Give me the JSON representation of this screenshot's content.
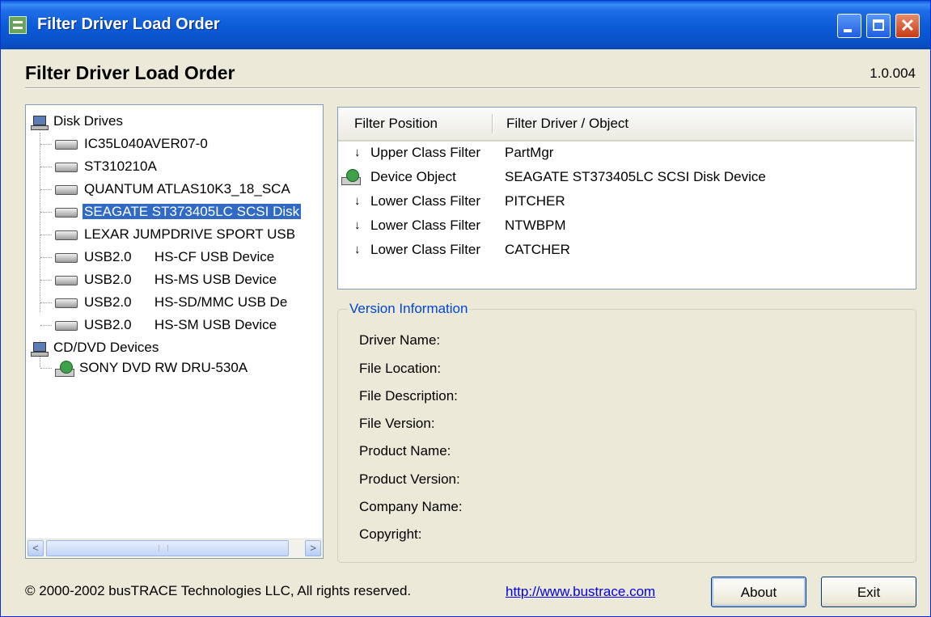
{
  "window": {
    "title": "Filter Driver Load Order",
    "controls": [
      "minimize",
      "maximize",
      "close"
    ],
    "close_glyph": "✕"
  },
  "header": {
    "title": "Filter Driver Load Order",
    "version": "1.0.004"
  },
  "tree": {
    "groups": [
      {
        "label": "Disk Drives",
        "icon": "computer-icon",
        "items": [
          "IC35L040AVER07-0",
          "ST310210A",
          "QUANTUM ATLAS10K3_18_SCA",
          "SEAGATE ST373405LC SCSI Disk",
          "LEXAR JUMPDRIVE SPORT USB",
          "USB2.0      HS-CF USB Device",
          "USB2.0      HS-MS USB Device",
          "USB2.0      HS-SD/MMC USB De",
          "USB2.0      HS-SM USB Device"
        ],
        "item_icon": "disk-drive-icon"
      },
      {
        "label": "CD/DVD Devices",
        "icon": "computer-icon",
        "items": [
          "SONY DVD RW DRU-530A"
        ],
        "item_icon": "cd-drive-icon"
      }
    ],
    "selected": "SEAGATE ST373405LC SCSI Disk",
    "scroll": {
      "left_glyph": "<",
      "right_glyph": ">"
    }
  },
  "filters": {
    "columns": [
      "Filter Position",
      "Filter Driver / Object"
    ],
    "rows": [
      {
        "arrow": "↓",
        "position": "Upper Class Filter",
        "driver": "PartMgr"
      },
      {
        "arrow": "",
        "position": "Device Object",
        "driver": "SEAGATE ST373405LC SCSI Disk Device"
      },
      {
        "arrow": "↓",
        "position": "Lower Class Filter",
        "driver": "PITCHER"
      },
      {
        "arrow": "↓",
        "position": "Lower Class Filter",
        "driver": "NTWBPM"
      },
      {
        "arrow": "↓",
        "position": "Lower Class Filter",
        "driver": "CATCHER"
      }
    ]
  },
  "version_info": {
    "legend": "Version Information",
    "labels": [
      "Driver Name:",
      "File Location:",
      "File Description:",
      "File Version:",
      "Product Name:",
      "Product Version:",
      "Company Name:",
      "Copyright:"
    ]
  },
  "footer": {
    "copyright": "© 2000-2002 busTRACE Technologies LLC,  All rights reserved.",
    "link": "http://www.bustrace.com",
    "about_label": "About",
    "exit_label": "Exit"
  },
  "colors": {
    "titlebar": "#0a52c8",
    "selection": "#316ac5",
    "dialog_bg": "#ece9d8",
    "legend_text": "#0046d5"
  }
}
